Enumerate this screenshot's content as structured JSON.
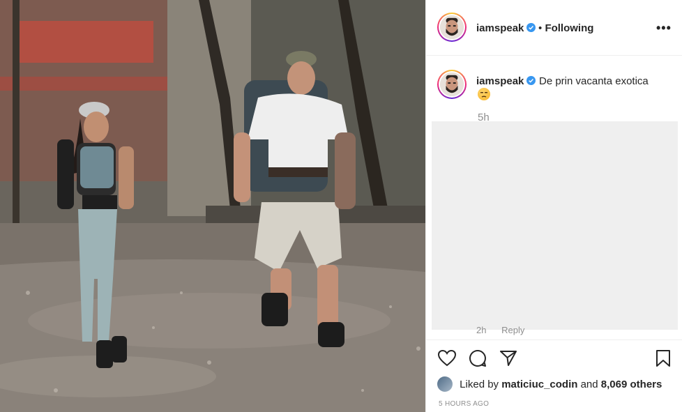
{
  "post": {
    "username": "iamspeak",
    "verified": true,
    "follow_sep": "•",
    "follow_status": "Following",
    "more_label": "•••"
  },
  "caption": {
    "username": "iamspeak",
    "text": "De prin vacanta exotica",
    "emoji": "unamused-face-emoji",
    "age": "5h"
  },
  "hidden_comment": {
    "age": "2h",
    "reply_label": "Reply"
  },
  "actions": {
    "like_icon": "heart-icon",
    "comment_icon": "comment-icon",
    "share_icon": "paper-plane-icon",
    "save_icon": "bookmark-icon"
  },
  "likes": {
    "prefix": "Liked by",
    "user": "maticiuc_codin",
    "conj": "and",
    "count": "8,069 others"
  },
  "timestamp": "5 HOURS AGO",
  "colors": {
    "verified_blue": "#3897f0",
    "muted_text": "#8e8e8e",
    "divider": "#efefef"
  }
}
